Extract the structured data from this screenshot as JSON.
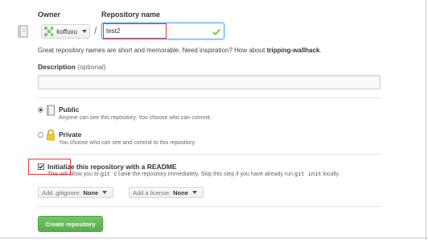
{
  "form": {
    "owner_label": "Owner",
    "repo_name_label": "Repository name",
    "owner_value": "koffuxu",
    "separator": "/",
    "repo_name_value": "test2",
    "hint_text": "Great repository names are short and memorable. Need inspiration? How about ",
    "hint_suggestion": "tripping-wallhack",
    "hint_end": ".",
    "description_label": "Description",
    "description_optional": "(optional)",
    "description_value": ""
  },
  "visibility": {
    "public_title": "Public",
    "public_desc": "Anyone can see this repository. You choose who can commit.",
    "private_title": "Private",
    "private_desc": "You choose who can see and commit to this repository.",
    "selected": "public"
  },
  "readme": {
    "label": "Initialize this repository with a README",
    "checked": true,
    "desc_1": "This will allow you to ",
    "desc_code_1": "git clone",
    "desc_2": " the repository immediately. Skip this step if you have already run ",
    "desc_code_2": "git init",
    "desc_3": " locally."
  },
  "selects": {
    "gitignore_prefix": "Add .gitignore:",
    "gitignore_value": "None",
    "license_prefix": "Add a license:",
    "license_value": "None"
  },
  "actions": {
    "create_label": "Create repository"
  },
  "colors": {
    "accent_blue": "#52a8ec",
    "success_green": "#5aae4d",
    "annotation_red": "#e03a3a",
    "check_green": "#6cc644"
  },
  "icons": {
    "repo": "repo-book-icon",
    "valid": "checkmark-icon",
    "public": "repo-public-icon",
    "private": "lock-icon"
  }
}
